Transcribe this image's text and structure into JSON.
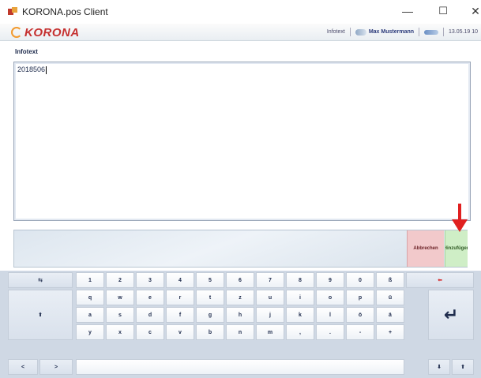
{
  "window": {
    "title": "KORONA.pos Client",
    "minimize": "—",
    "maximize": "☐",
    "close": "✕"
  },
  "header": {
    "logo_text": "KORONA",
    "section": "Infotext",
    "user": "Max Mustermann",
    "date": "13.05.19 10"
  },
  "infotext": {
    "label": "Infotext",
    "value": "2018506"
  },
  "actions": {
    "cancel": "Abbrechen",
    "add": "Hinzufügen"
  },
  "keyboard": {
    "row1": [
      "1",
      "2",
      "3",
      "4",
      "5",
      "6",
      "7",
      "8",
      "9",
      "0",
      "ß"
    ],
    "row2": [
      "q",
      "w",
      "e",
      "r",
      "t",
      "z",
      "u",
      "i",
      "o",
      "p",
      "ü"
    ],
    "row3": [
      "a",
      "s",
      "d",
      "f",
      "g",
      "h",
      "j",
      "k",
      "l",
      "ö",
      "ä"
    ],
    "row4": [
      "y",
      "x",
      "c",
      "v",
      "b",
      "n",
      "m",
      ",",
      ".",
      "-",
      "+"
    ],
    "tab": "⇆",
    "backspace": "⬅",
    "shift": "⬆",
    "enter": "↵",
    "nav_left": "<",
    "nav_right": ">",
    "down": "⬇",
    "up": "⬆"
  },
  "colors": {
    "cancel_bg": "#f2c9cb",
    "add_bg": "#cfeec6",
    "accent_red": "#c5302f",
    "backspace_red": "#d62b2b"
  }
}
